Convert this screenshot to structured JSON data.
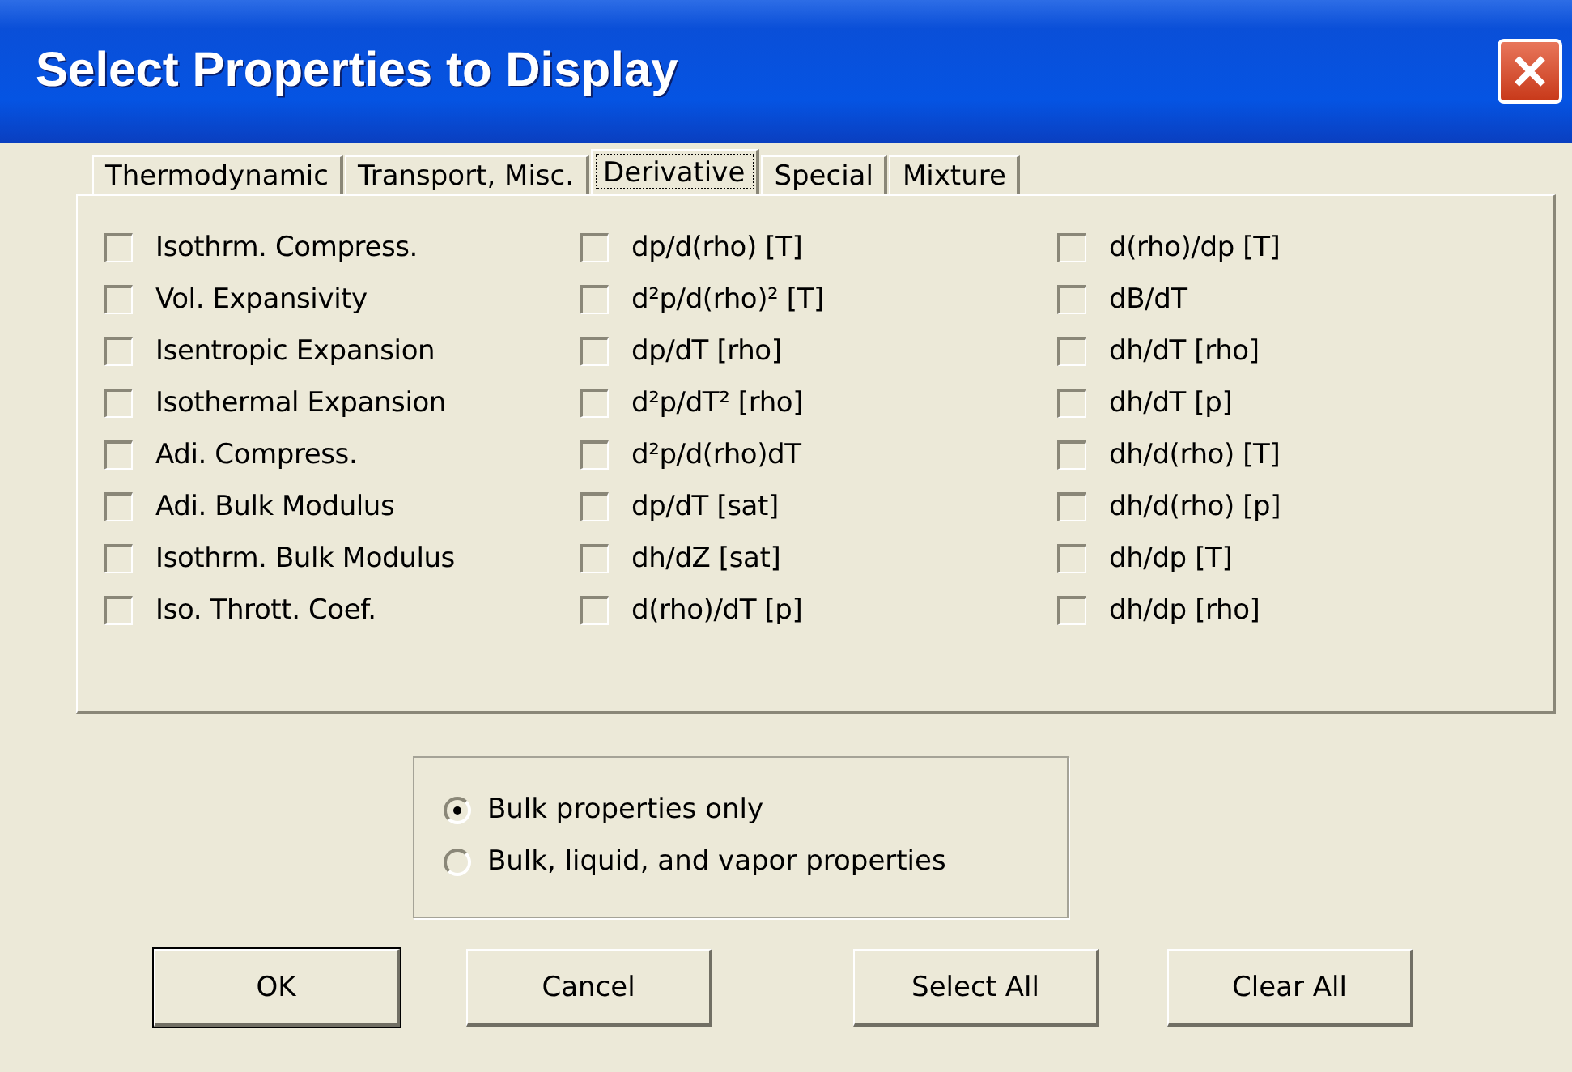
{
  "window": {
    "title": "Select Properties to Display"
  },
  "tabs": [
    {
      "label": "Thermodynamic",
      "selected": false
    },
    {
      "label": "Transport, Misc.",
      "selected": false
    },
    {
      "label": "Derivative",
      "selected": true
    },
    {
      "label": "Special",
      "selected": false
    },
    {
      "label": "Mixture",
      "selected": false
    }
  ],
  "columns": [
    {
      "items": [
        {
          "label": "Isothrm. Compress.",
          "checked": false
        },
        {
          "label": "Vol. Expansivity",
          "checked": false
        },
        {
          "label": "Isentropic Expansion",
          "checked": false
        },
        {
          "label": "Isothermal Expansion",
          "checked": false
        },
        {
          "label": "Adi. Compress.",
          "checked": false
        },
        {
          "label": "Adi. Bulk Modulus",
          "checked": false
        },
        {
          "label": "Isothrm. Bulk Modulus",
          "checked": false
        },
        {
          "label": "Iso. Thrott. Coef.",
          "checked": false
        }
      ]
    },
    {
      "items": [
        {
          "label": "dp/d(rho) [T]",
          "checked": false
        },
        {
          "label": "d²p/d(rho)² [T]",
          "checked": false
        },
        {
          "label": "dp/dT [rho]",
          "checked": false
        },
        {
          "label": "d²p/dT² [rho]",
          "checked": false
        },
        {
          "label": "d²p/d(rho)dT",
          "checked": false
        },
        {
          "label": "dp/dT [sat]",
          "checked": false
        },
        {
          "label": "dh/dZ [sat]",
          "checked": false
        },
        {
          "label": "d(rho)/dT [p]",
          "checked": false
        }
      ]
    },
    {
      "items": [
        {
          "label": "d(rho)/dp [T]",
          "checked": false
        },
        {
          "label": "dB/dT",
          "checked": false
        },
        {
          "label": "dh/dT [rho]",
          "checked": false
        },
        {
          "label": "dh/dT [p]",
          "checked": false
        },
        {
          "label": "dh/d(rho) [T]",
          "checked": false
        },
        {
          "label": "dh/d(rho) [p]",
          "checked": false
        },
        {
          "label": "dh/dp [T]",
          "checked": false
        },
        {
          "label": "dh/dp [rho]",
          "checked": false
        }
      ]
    }
  ],
  "phase_options": [
    {
      "label": "Bulk properties only",
      "selected": true
    },
    {
      "label": "Bulk, liquid, and vapor properties",
      "selected": false
    }
  ],
  "buttons": [
    {
      "label": "OK",
      "default": true
    },
    {
      "label": "Cancel",
      "default": false
    },
    {
      "label": "Select All",
      "default": false
    },
    {
      "label": "Clear All",
      "default": false
    }
  ]
}
